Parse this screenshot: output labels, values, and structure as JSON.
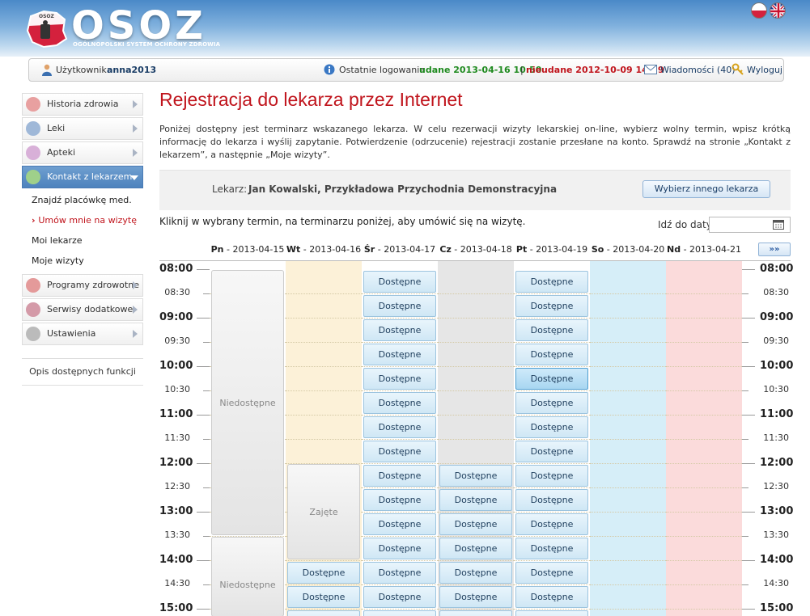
{
  "header": {
    "logo_text": "OSOZ",
    "logo_emblem_text": "OSOZ",
    "logo_sub": "OGÓLNOPOLSKI SYSTEM OCHRONY ZDROWIA"
  },
  "userbar": {
    "user_label": "Użytkownik:",
    "user_name": "anna2013",
    "last_login_label": "Ostatnie logowania",
    "success_label": "udane 2013-04-16 10:50",
    "separator": "|",
    "fail_label": "nieudane 2012-10-09 14:39",
    "messages_label": "Wiadomości (40)",
    "logout_label": "Wyloguj"
  },
  "sidebar": {
    "items": [
      {
        "label": "Historia zdrowia",
        "icon": "medical-cross-icon"
      },
      {
        "label": "Leki",
        "icon": "pill-icon"
      },
      {
        "label": "Apteki",
        "icon": "mortar-icon"
      },
      {
        "label": "Kontakt z lekarzem",
        "icon": "doctor-icon"
      },
      {
        "label": "Programy zdrowotne",
        "icon": "shield-icon"
      },
      {
        "label": "Serwisy dodatkowe",
        "icon": "services-icon"
      },
      {
        "label": "Ustawienia",
        "icon": "gear-icon"
      }
    ],
    "sub_items": [
      "Znajdź placówkę med.",
      "Umów mnie na wizytę",
      "Moi lekarze",
      "Moje wizyty"
    ],
    "functions_label": "Opis dostępnych funkcji"
  },
  "main": {
    "title": "Rejestracja do lekarza przez Internet",
    "intro": "Poniżej dostępny jest terminarz wskazanego lekarza. W celu rezerwacji wizyty lekarskiej on-line, wybierz wolny termin, wpisz krótką informację do lekarza i wyślij zapytanie. Potwierdzenie (odrzucenie) rejestracji zostanie przesłane na konto. Sprawdź na stronie „Kontakt z lekarzem”, a następnie „Moje wizyty”.",
    "doctor_label": "Lekarz:",
    "doctor_value": "Jan Kowalski, Przykładowa Przychodnia Demonstracyjna",
    "change_doctor_button": "Wybierz innego lekarza",
    "hint": "Kliknij w wybrany termin, na terminarzu poniżej, aby umówić się na wizytę.",
    "goto_label": "Idź do daty:",
    "goto_value": ""
  },
  "calendar": {
    "next_button": "»»",
    "days": [
      {
        "abbr": "Pn",
        "date": "2013-04-15",
        "bg": "#ffffff"
      },
      {
        "abbr": "Wt",
        "date": "2013-04-16",
        "bg": "#fcf1d8"
      },
      {
        "abbr": "Śr",
        "date": "2013-04-17",
        "bg": "#ffffff"
      },
      {
        "abbr": "Cz",
        "date": "2013-04-18",
        "bg": "#e6e6e6"
      },
      {
        "abbr": "Pt",
        "date": "2013-04-19",
        "bg": "#ffffff"
      },
      {
        "abbr": "So",
        "date": "2013-04-20",
        "bg": "#d6eef8"
      },
      {
        "abbr": "Nd",
        "date": "2013-04-21",
        "bg": "#fbdbdb"
      }
    ],
    "times": [
      "08:00",
      "08:30",
      "09:00",
      "09:30",
      "10:00",
      "10:30",
      "11:00",
      "11:30",
      "12:00",
      "12:30",
      "13:00",
      "13:30",
      "14:00",
      "14:30",
      "15:00"
    ],
    "free_label": "Dostępne",
    "blocks": [
      {
        "day": 0,
        "from": 0,
        "to": 11,
        "label": "Niedostępne"
      },
      {
        "day": 0,
        "from": 11,
        "to": 15,
        "label": "Niedostępne"
      },
      {
        "day": 1,
        "from": 8,
        "to": 12,
        "label": "Zajęte"
      }
    ],
    "free_slots": [
      {
        "day": 1,
        "slots": [
          12,
          13,
          14
        ]
      },
      {
        "day": 2,
        "slots": [
          0,
          1,
          2,
          3,
          4,
          5,
          6,
          7,
          8,
          9,
          10,
          11,
          12,
          13,
          14
        ]
      },
      {
        "day": 3,
        "slots": [
          8,
          9,
          10,
          11,
          12,
          13,
          14
        ]
      },
      {
        "day": 4,
        "slots": [
          0,
          1,
          2,
          3,
          4,
          5,
          6,
          7,
          8,
          9,
          10,
          11,
          12,
          13,
          14
        ]
      }
    ],
    "highlighted": {
      "day": 4,
      "slot": 4
    },
    "colors": {
      "free_border": "#9cc4df",
      "highlight": "#4f9fd1",
      "title_red": "#c0141c"
    }
  }
}
